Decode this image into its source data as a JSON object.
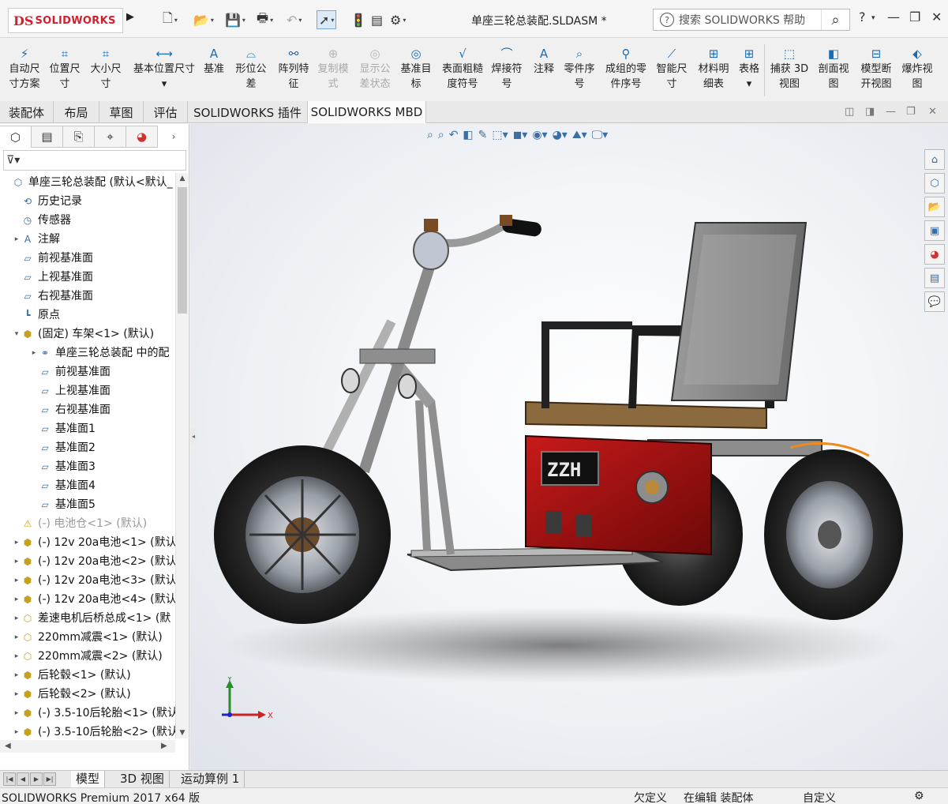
{
  "app": {
    "logo_mark": "DS",
    "logo_text": "SOLIDWORKS",
    "document_title": "单座三轮总装配.SLDASM *"
  },
  "quick_access": {
    "icons": [
      "new-file-icon",
      "open-file-icon",
      "save-icon",
      "print-icon",
      "undo-icon",
      "select-cursor-icon",
      "rebuild-icon",
      "file-properties-icon",
      "options-gear-icon"
    ]
  },
  "search": {
    "placeholder": "搜索 SOLIDWORKS 帮助"
  },
  "window_controls": {
    "help": "?",
    "minimize": "—",
    "restore": "❐",
    "close": "✕"
  },
  "ribbon": {
    "buttons": [
      {
        "label1": "自动尺",
        "label2": "寸方案",
        "icon": "auto-dimension-icon"
      },
      {
        "label1": "位置尺",
        "label2": "寸",
        "icon": "location-dimension-icon"
      },
      {
        "label1": "大小尺",
        "label2": "寸",
        "icon": "size-dimension-icon"
      },
      {
        "label1": "基本位置尺寸",
        "label2": "▾",
        "icon": "basic-location-dimension-icon"
      },
      {
        "label1": "基准",
        "label2": "",
        "icon": "datum-icon"
      },
      {
        "label1": "形位公",
        "label2": "差",
        "icon": "geometric-tolerance-icon"
      },
      {
        "label1": "阵列特",
        "label2": "征",
        "icon": "pattern-feature-icon"
      },
      {
        "label1": "复制模",
        "label2": "式",
        "icon": "copy-scheme-icon",
        "disabled": true
      },
      {
        "label1": "显示公",
        "label2": "差状态",
        "icon": "show-tolerance-status-icon",
        "disabled": true
      },
      {
        "label1": "基准目",
        "label2": "标",
        "icon": "datum-target-icon"
      },
      {
        "label1": "表面粗糙",
        "label2": "度符号",
        "icon": "surface-finish-icon"
      },
      {
        "label1": "焊接符",
        "label2": "号",
        "icon": "weld-symbol-icon"
      },
      {
        "label1": "注释",
        "label2": "",
        "icon": "note-icon"
      },
      {
        "label1": "零件序",
        "label2": "号",
        "icon": "balloon-icon"
      },
      {
        "label1": "成组的零",
        "label2": "件序号",
        "icon": "stacked-balloon-icon"
      },
      {
        "label1": "智能尺",
        "label2": "寸",
        "icon": "smart-dimension-icon"
      },
      {
        "label1": "材料明",
        "label2": "细表",
        "icon": "bill-of-materials-icon"
      },
      {
        "label1": "表格",
        "label2": "▾",
        "icon": "table-icon"
      },
      {
        "label1": "捕获 3D",
        "label2": "视图",
        "icon": "capture-3d-view-icon"
      },
      {
        "label1": "剖面视",
        "label2": "图",
        "icon": "section-view-icon"
      },
      {
        "label1": "模型断",
        "label2": "开视图",
        "icon": "model-break-view-icon"
      },
      {
        "label1": "爆炸视",
        "label2": "图",
        "icon": "explode-view-icon"
      }
    ]
  },
  "tabs": [
    "装配体",
    "布局",
    "草图",
    "评估",
    "SOLIDWORKS 插件",
    "SOLIDWORKS MBD"
  ],
  "active_tab": "SOLIDWORKS MBD",
  "panel_tabs": [
    "feature-manager-icon",
    "property-manager-icon",
    "configuration-manager-icon",
    "dimxpert-icon",
    "display-manager-icon"
  ],
  "tree": {
    "nodes": [
      {
        "label": "单座三轮总装配  (默认<默认_",
        "level": 0,
        "arrow": "",
        "icon": "assembly-icon"
      },
      {
        "label": "历史记录",
        "level": 1,
        "arrow": "",
        "icon": "history-icon"
      },
      {
        "label": "传感器",
        "level": 1,
        "arrow": "",
        "icon": "sensor-icon"
      },
      {
        "label": "注解",
        "level": 1,
        "arrow": "▸",
        "icon": "annotation-icon"
      },
      {
        "label": "前视基准面",
        "level": 1,
        "arrow": "",
        "icon": "plane-icon"
      },
      {
        "label": "上视基准面",
        "level": 1,
        "arrow": "",
        "icon": "plane-icon"
      },
      {
        "label": "右视基准面",
        "level": 1,
        "arrow": "",
        "icon": "plane-icon"
      },
      {
        "label": "原点",
        "level": 1,
        "arrow": "",
        "icon": "origin-icon"
      },
      {
        "label": "(固定) 车架<1> (默认)",
        "level": 1,
        "arrow": "▾",
        "icon": "part-icon"
      },
      {
        "label": "单座三轮总装配 中的配",
        "level": 2,
        "arrow": "▸",
        "icon": "mates-icon"
      },
      {
        "label": "前视基准面",
        "level": 2,
        "arrow": "",
        "icon": "plane-icon"
      },
      {
        "label": "上视基准面",
        "level": 2,
        "arrow": "",
        "icon": "plane-icon"
      },
      {
        "label": "右视基准面",
        "level": 2,
        "arrow": "",
        "icon": "plane-icon"
      },
      {
        "label": "基准面1",
        "level": 2,
        "arrow": "",
        "icon": "plane-icon"
      },
      {
        "label": "基准面2",
        "level": 2,
        "arrow": "",
        "icon": "plane-icon"
      },
      {
        "label": "基准面3",
        "level": 2,
        "arrow": "",
        "icon": "plane-icon"
      },
      {
        "label": "基准面4",
        "level": 2,
        "arrow": "",
        "icon": "plane-icon"
      },
      {
        "label": "基准面5",
        "level": 2,
        "arrow": "",
        "icon": "plane-icon"
      },
      {
        "label": "(-) 电池仓<1> (默认)",
        "level": 1,
        "arrow": "",
        "icon": "warning-icon",
        "dim": true
      },
      {
        "label": "(-) 12v 20a电池<1> (默认",
        "level": 1,
        "arrow": "▸",
        "icon": "part-icon"
      },
      {
        "label": "(-) 12v 20a电池<2> (默认",
        "level": 1,
        "arrow": "▸",
        "icon": "part-icon"
      },
      {
        "label": "(-) 12v 20a电池<3> (默认",
        "level": 1,
        "arrow": "▸",
        "icon": "part-icon"
      },
      {
        "label": "(-) 12v 20a电池<4> (默认",
        "level": 1,
        "arrow": "▸",
        "icon": "part-icon"
      },
      {
        "label": "差速电机后桥总成<1> (默",
        "level": 1,
        "arrow": "▸",
        "icon": "subassembly-icon"
      },
      {
        "label": "220mm减震<1> (默认)",
        "level": 1,
        "arrow": "▸",
        "icon": "subassembly-icon"
      },
      {
        "label": "220mm减震<2> (默认)",
        "level": 1,
        "arrow": "▸",
        "icon": "subassembly-icon"
      },
      {
        "label": "后轮毂<1> (默认)",
        "level": 1,
        "arrow": "▸",
        "icon": "part-icon"
      },
      {
        "label": "后轮毂<2> (默认)",
        "level": 1,
        "arrow": "▸",
        "icon": "part-icon"
      },
      {
        "label": "(-) 3.5-10后轮胎<1> (默认",
        "level": 1,
        "arrow": "▸",
        "icon": "part-icon"
      },
      {
        "label": "(-) 3.5-10后轮胎<2> (默认",
        "level": 1,
        "arrow": "▸",
        "icon": "part-icon"
      }
    ]
  },
  "triad": {
    "x": "X",
    "y": "Y",
    "z": "Z"
  },
  "bottom_tabs": [
    "模型",
    "3D 视图",
    "运动算例 1"
  ],
  "active_bottom_tab": "模型",
  "status": {
    "version": "SOLIDWORKS Premium 2017 x64 版",
    "constraint": "欠定义",
    "mode": "在编辑 装配体",
    "units": "自定义"
  },
  "model": {
    "seat_badge": "ZZH"
  }
}
